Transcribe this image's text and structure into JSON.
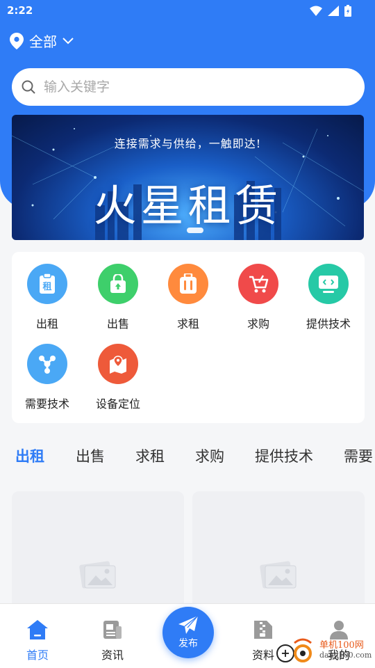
{
  "status_bar": {
    "time": "2:22"
  },
  "location": {
    "label": "全部"
  },
  "search": {
    "placeholder": "输入关键字"
  },
  "banner": {
    "slogan": "连接需求与供给，一触即达!",
    "title": "火星租赁"
  },
  "categories": [
    {
      "label": "出租",
      "color": "#4aa8f5",
      "icon": "rent-icon"
    },
    {
      "label": "出售",
      "color": "#3ecf6b",
      "icon": "sale-bag-icon"
    },
    {
      "label": "求租",
      "color": "#ff8a3d",
      "icon": "luggage-icon"
    },
    {
      "label": "求购",
      "color": "#f04a4a",
      "icon": "cart-icon"
    },
    {
      "label": "提供技术",
      "color": "#26c9a6",
      "icon": "code-icon"
    },
    {
      "label": "需要技术",
      "color": "#4aa8f5",
      "icon": "network-icon"
    },
    {
      "label": "设备定位",
      "color": "#ee5a3a",
      "icon": "map-pin-icon"
    }
  ],
  "tabs": [
    "出租",
    "出售",
    "求租",
    "求购",
    "提供技术",
    "需要"
  ],
  "bottom_nav": {
    "home": "首页",
    "news": "资讯",
    "publish": "发布",
    "materials": "资料",
    "mine": "我的"
  },
  "watermark": {
    "line1": "单机100网",
    "line2": "danji100.com"
  },
  "colors": {
    "accent": "#2f7cf6"
  }
}
